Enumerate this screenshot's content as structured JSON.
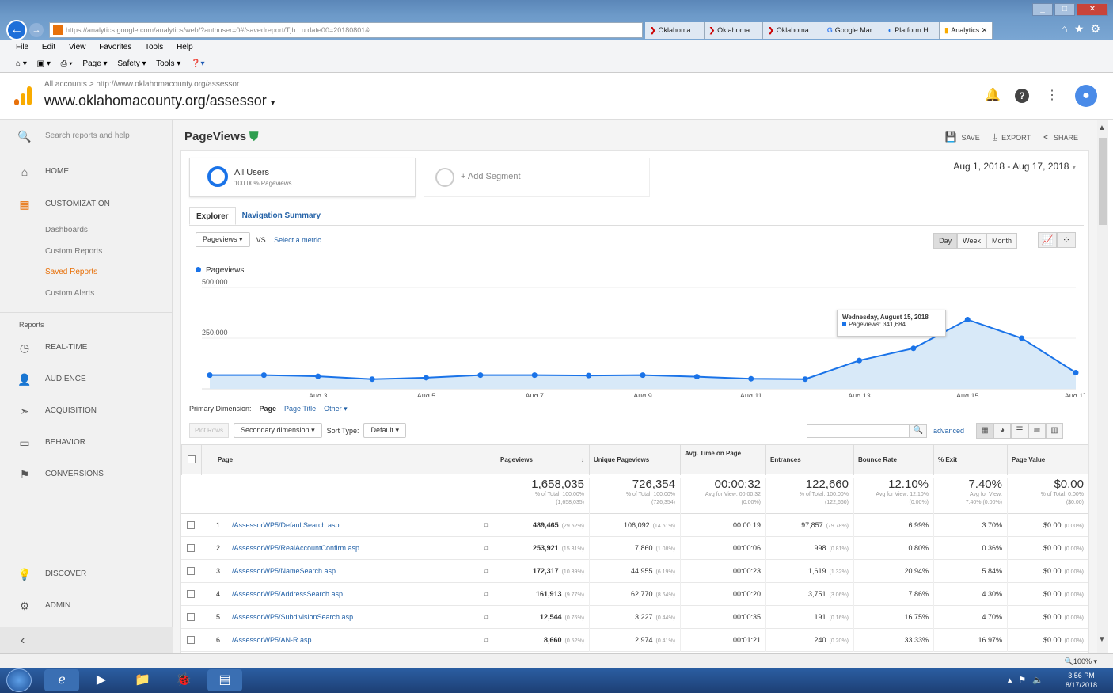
{
  "browser": {
    "url": "https://analytics.google.com/analytics/web/?authuser=0#/savedreport/Tjh...u.date00=20180801&",
    "url_host": "analytics.google.com",
    "tabs": [
      {
        "label": "Oklahoma ...",
        "active": false
      },
      {
        "label": "Oklahoma ...",
        "active": false
      },
      {
        "label": "Oklahoma ...",
        "active": false
      },
      {
        "label": "Google Mar...",
        "active": false
      },
      {
        "label": "Platform H...",
        "active": false
      },
      {
        "label": "Analytics",
        "active": true
      }
    ],
    "menu": [
      "File",
      "Edit",
      "View",
      "Favorites",
      "Tools",
      "Help"
    ],
    "commands": [
      "Page ▾",
      "Safety ▾",
      "Tools ▾"
    ],
    "zoom": "100%"
  },
  "header": {
    "breadcrumb": "All accounts > http://www.oklahomacounty.org/assessor",
    "property": "www.oklahomacounty.org/assessor"
  },
  "sidebar": {
    "search_placeholder": "Search reports and help",
    "home": "HOME",
    "customization": "CUSTOMIZATION",
    "custom_items": [
      "Dashboards",
      "Custom Reports",
      "Saved Reports",
      "Custom Alerts"
    ],
    "reports_heading": "Reports",
    "reports": [
      "REAL-TIME",
      "AUDIENCE",
      "ACQUISITION",
      "BEHAVIOR",
      "CONVERSIONS"
    ],
    "discover": "DISCOVER",
    "admin": "ADMIN"
  },
  "report": {
    "title": "PageViews",
    "actions": {
      "save": "SAVE",
      "export": "EXPORT",
      "share": "SHARE"
    },
    "segment": {
      "name": "All Users",
      "sub": "100.00% Pageviews",
      "add": "+ Add Segment"
    },
    "date_range": "Aug 1, 2018 - Aug 17, 2018",
    "tabs": [
      "Explorer",
      "Navigation Summary"
    ],
    "metric": "Pageviews",
    "vs": "VS.",
    "select_metric": "Select a metric",
    "granularity": [
      "Day",
      "Week",
      "Month"
    ],
    "tooltip": {
      "date": "Wednesday, August 15, 2018",
      "value": "Pageviews: 341,684"
    },
    "primary_dimension_label": "Primary Dimension:",
    "dimensions": [
      "Page",
      "Page Title",
      "Other ▾"
    ],
    "plot_rows": "Plot Rows",
    "secondary_dimension": "Secondary dimension",
    "sort_type_label": "Sort Type:",
    "sort_type": "Default",
    "advanced": "advanced"
  },
  "chart_data": {
    "type": "area",
    "series": [
      {
        "name": "Pageviews"
      }
    ],
    "x": [
      "Aug 1",
      "Aug 2",
      "Aug 3",
      "Aug 4",
      "Aug 5",
      "Aug 6",
      "Aug 7",
      "Aug 8",
      "Aug 9",
      "Aug 10",
      "Aug 11",
      "Aug 12",
      "Aug 13",
      "Aug 14",
      "Aug 15",
      "Aug 16",
      "Aug 17"
    ],
    "values": [
      68000,
      68000,
      62000,
      48000,
      55000,
      68000,
      68000,
      66000,
      68000,
      60000,
      50000,
      48000,
      140000,
      200000,
      341684,
      250000,
      80000
    ],
    "ylim": [
      0,
      500000
    ],
    "y_ticks": [
      "250,000",
      "500,000"
    ],
    "x_tick_labels": [
      "...",
      "Aug 3",
      "Aug 5",
      "Aug 7",
      "Aug 9",
      "Aug 11",
      "Aug 13",
      "Aug 15",
      "Aug 17"
    ],
    "color": "#1a73e8",
    "fill": "#d8e9f8"
  },
  "table": {
    "columns": [
      "Page",
      "Pageviews",
      "Unique Pageviews",
      "Avg. Time on Page",
      "Entrances",
      "Bounce Rate",
      "% Exit",
      "Page Value"
    ],
    "totals": [
      {
        "big": "1,658,035",
        "s1": "% of Total: 100.00%",
        "s2": "(1,658,035)"
      },
      {
        "big": "726,354",
        "s1": "% of Total: 100.00%",
        "s2": "(726,354)"
      },
      {
        "big": "00:00:32",
        "s1": "Avg for View: 00:00:32",
        "s2": "(0.00%)"
      },
      {
        "big": "122,660",
        "s1": "% of Total: 100.00%",
        "s2": "(122,660)"
      },
      {
        "big": "12.10%",
        "s1": "Avg for View: 12.10%",
        "s2": "(0.00%)"
      },
      {
        "big": "7.40%",
        "s1": "Avg for View:",
        "s2": "7.40% (0.00%)"
      },
      {
        "big": "$0.00",
        "s1": "% of Total: 0.00%",
        "s2": "($0.00)"
      }
    ],
    "rows": [
      {
        "n": "1.",
        "page": "/AssessorWP5/DefaultSearch.asp",
        "pv": "489,465",
        "pvp": "(29.52%)",
        "upv": "106,092",
        "upvp": "(14.61%)",
        "time": "00:00:19",
        "ent": "97,857",
        "entp": "(79.78%)",
        "br": "6.99%",
        "exit": "3.70%",
        "val": "$0.00",
        "valp": "(0.00%)"
      },
      {
        "n": "2.",
        "page": "/AssessorWP5/RealAccountConfirm.asp",
        "pv": "253,921",
        "pvp": "(15.31%)",
        "upv": "7,860",
        "upvp": "(1.08%)",
        "time": "00:00:06",
        "ent": "998",
        "entp": "(0.81%)",
        "br": "0.80%",
        "exit": "0.36%",
        "val": "$0.00",
        "valp": "(0.00%)"
      },
      {
        "n": "3.",
        "page": "/AssessorWP5/NameSearch.asp",
        "pv": "172,317",
        "pvp": "(10.39%)",
        "upv": "44,955",
        "upvp": "(6.19%)",
        "time": "00:00:23",
        "ent": "1,619",
        "entp": "(1.32%)",
        "br": "20.94%",
        "exit": "5.84%",
        "val": "$0.00",
        "valp": "(0.00%)"
      },
      {
        "n": "4.",
        "page": "/AssessorWP5/AddressSearch.asp",
        "pv": "161,913",
        "pvp": "(9.77%)",
        "upv": "62,770",
        "upvp": "(8.64%)",
        "time": "00:00:20",
        "ent": "3,751",
        "entp": "(3.06%)",
        "br": "7.86%",
        "exit": "4.30%",
        "val": "$0.00",
        "valp": "(0.00%)"
      },
      {
        "n": "5.",
        "page": "/AssessorWP5/SubdivisionSearch.asp",
        "pv": "12,544",
        "pvp": "(0.76%)",
        "upv": "3,227",
        "upvp": "(0.44%)",
        "time": "00:00:35",
        "ent": "191",
        "entp": "(0.16%)",
        "br": "16.75%",
        "exit": "4.70%",
        "val": "$0.00",
        "valp": "(0.00%)"
      },
      {
        "n": "6.",
        "page": "/AssessorWP5/AN-R.asp",
        "pv": "8,660",
        "pvp": "(0.52%)",
        "upv": "2,974",
        "upvp": "(0.41%)",
        "time": "00:01:21",
        "ent": "240",
        "entp": "(0.20%)",
        "br": "33.33%",
        "exit": "16.97%",
        "val": "$0.00",
        "valp": "(0.00%)"
      }
    ]
  },
  "taskbar": {
    "time": "3:56 PM",
    "date": "8/17/2018"
  }
}
